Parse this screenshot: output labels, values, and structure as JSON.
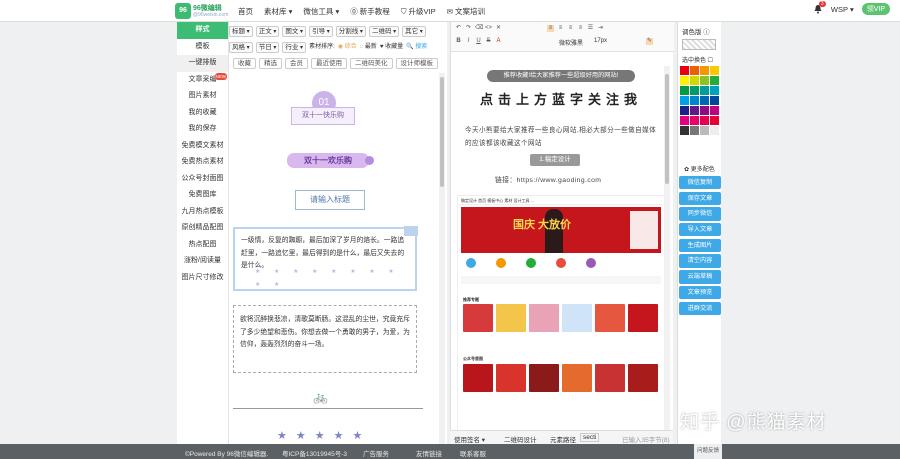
{
  "logo": {
    "mark": "96",
    "name": "96微编辑",
    "sub": "@96weixin.com"
  },
  "nav": [
    {
      "label": "首页"
    },
    {
      "label": "素材库 ▾"
    },
    {
      "label": "微信工具 ▾"
    },
    {
      "label": "⓪ 新手教程"
    },
    {
      "label": "⛉ 升级VIP"
    },
    {
      "label": "✉ 文案培训"
    }
  ],
  "user": {
    "notif_count": "3",
    "name": "WSP ▾",
    "vip": "领VIP"
  },
  "leftnav": [
    "样式",
    "模板",
    "一键排版",
    "文章采编",
    "图片素材",
    "我的收藏",
    "我的保存",
    "免费模文素材",
    "免费热点素材",
    "公众号封面图",
    "免费图库",
    "九月热点模板",
    "原创精品配图",
    "热点配图",
    "涨粉/阅读量",
    "图片尺寸修改"
  ],
  "leftnav_new_tag": "NEW",
  "style_toolbar": {
    "row1": [
      "标题",
      "正文",
      "图文",
      "引导",
      "分割线",
      "二维码",
      "其它"
    ],
    "row2": [
      "风格",
      "节日",
      "行业"
    ],
    "row2_text": [
      "素材排序:",
      "◉ 综合",
      "◌ 最新",
      "♥ 收藏量"
    ],
    "row2_search": "🔍 搜索",
    "row3": [
      "收藏",
      "精选",
      "会员",
      "最近使用",
      "二维码美化",
      "设计师模板"
    ]
  },
  "styles": {
    "s1_num": "01",
    "s1_label": "双十一快乐购",
    "s2_label": "双十一欢乐购",
    "s3_label": "请输入标题",
    "s4_text": "一级情，反复的踟蹰，最后加深了岁月的烙长。一路追赶里，一路追忆里，最后得到的是什么，最后又失去的是什么。",
    "s4_stars": "★ ★ ★ ★ ★ ★ ★ ★ ★ ★",
    "s5_text": "欲将沉醉换悲凉，清歌莫断肠。这混乱的尘世，究竟充斥了多少绝望和悲伤。你想去做一个勇敢的男子，为爱，为信仰，轰轰烈烈的奋斗一场。",
    "s6_icon": "🚲",
    "s7_stars": "★★★★★"
  },
  "editor": {
    "toolbar_font_size": "17px",
    "toolbar_font": "微软雅黑",
    "top_bar": "推荐收藏!给大家推荐一些超级好用的网站!",
    "title": "点击上方蓝字关注我",
    "intro": "今天小熊要给大家推荐一些良心网站,相必大部分一些做自媒体的应该都该收藏这个网站",
    "btn": "1.稿定设计",
    "link": "链接：https://www.gaoding.com",
    "shot_header": "稿定设计   首页  模板中心  素材  设计工具  …",
    "shot_banner": "国庆 大放价",
    "shot_sec1": "推荐专题",
    "shot_sec2": "公众号首图"
  },
  "colorpanel": {
    "title": "调色版 ⓘ",
    "sub": "选中换色 ☐",
    "more": "✿ 更多配色",
    "swatches": [
      "#e60012",
      "#eb6100",
      "#f39800",
      "#fcc800",
      "#fff100",
      "#cfdb00",
      "#8fc31f",
      "#22ac38",
      "#009944",
      "#009b6b",
      "#009e96",
      "#00a0c1",
      "#00a0e9",
      "#0086d1",
      "#0068b7",
      "#00479d",
      "#1d2088",
      "#601986",
      "#920783",
      "#be0081",
      "#e4007f",
      "#e5006a",
      "#e5004f",
      "#e60033",
      "#333333",
      "#777777",
      "#bbbbbb",
      "#eeeeee"
    ],
    "actions": [
      "微信复制",
      "保存文章",
      "同步微信",
      "导入文章",
      "生成图片",
      "清空内容",
      "云端草稿",
      "文章预览",
      "进群交流"
    ]
  },
  "status": {
    "left": "使用签名 ▾",
    "mid": "二维码设计",
    "path_label": "元素路径",
    "path_val": "secti",
    "count": "已输入35字节(8)"
  },
  "footer": [
    "©Powered By 96微信编辑器.",
    "粤ICP备13019945号-3",
    "广告服务",
    "友情链接",
    "联系客服"
  ],
  "feedback": "问题反馈",
  "watermark": "知乎 @熊猫素材",
  "colors": {
    "accent": "#3dbc73",
    "action": "#3fa9e7",
    "footer": "#5b6064"
  }
}
